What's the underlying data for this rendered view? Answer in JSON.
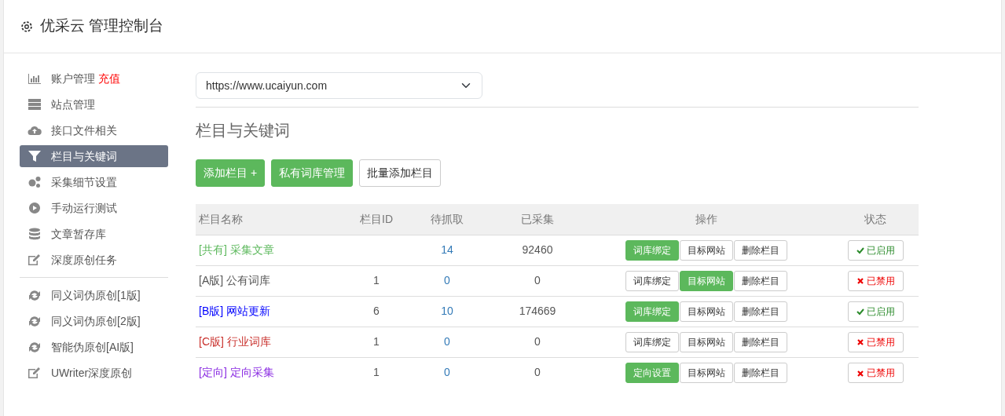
{
  "header": {
    "title": "优采云 管理控制台"
  },
  "sidebar": {
    "items": [
      {
        "label": "账户管理",
        "extra": "充值",
        "selected": false
      },
      {
        "label": "站点管理",
        "selected": false
      },
      {
        "label": "接口文件相关",
        "selected": false
      },
      {
        "label": "栏目与关键词",
        "selected": true
      },
      {
        "label": "采集细节设置",
        "selected": false
      },
      {
        "label": "手动运行测试",
        "selected": false
      },
      {
        "label": "文章暂存库",
        "selected": false
      },
      {
        "label": "深度原创任务",
        "selected": false
      }
    ],
    "tools": [
      {
        "label": "同义词伪原创[1版]"
      },
      {
        "label": "同义词伪原创[2版]"
      },
      {
        "label": "智能伪原创[AI版]"
      },
      {
        "label": "UWriter深度原创"
      }
    ]
  },
  "site_select": {
    "value": "https://www.ucaiyun.com"
  },
  "section_title": "栏目与关键词",
  "actions": [
    {
      "label": "添加栏目 +",
      "kind": "primary"
    },
    {
      "label": "私有词库管理",
      "kind": "primary"
    },
    {
      "label": "批量添加栏目",
      "kind": "outline"
    }
  ],
  "table": {
    "columns": [
      "栏目名称",
      "栏目ID",
      "待抓取",
      "已采集",
      "操作",
      "状态"
    ],
    "rows": [
      {
        "tag": "[共有]",
        "name": "采集文章",
        "color": "#5cb85c",
        "id": "",
        "pending": "14",
        "collected": "92460",
        "ops": [
          {
            "label": "词库绑定",
            "kind": "primary"
          },
          {
            "label": "目标网站",
            "kind": "outline"
          },
          {
            "label": "删除栏目",
            "kind": "outline"
          }
        ],
        "status": "已启用",
        "on": true
      },
      {
        "tag": "[A版]",
        "name": "公有词库",
        "color": "#555555",
        "id": "1",
        "pending": "0",
        "collected": "0",
        "ops": [
          {
            "label": "词库绑定",
            "kind": "outline"
          },
          {
            "label": "目标网站",
            "kind": "primary"
          },
          {
            "label": "删除栏目",
            "kind": "outline"
          }
        ],
        "status": "已禁用",
        "on": false
      },
      {
        "tag": "[B版]",
        "name": "网站更新",
        "color": "#0000ff",
        "id": "6",
        "pending": "10",
        "collected": "174669",
        "ops": [
          {
            "label": "词库绑定",
            "kind": "primary"
          },
          {
            "label": "目标网站",
            "kind": "outline"
          },
          {
            "label": "删除栏目",
            "kind": "outline"
          }
        ],
        "status": "已启用",
        "on": true
      },
      {
        "tag": "[C版]",
        "name": "行业词库",
        "color": "#c9302c",
        "id": "1",
        "pending": "0",
        "collected": "0",
        "ops": [
          {
            "label": "词库绑定",
            "kind": "outline"
          },
          {
            "label": "目标网站",
            "kind": "outline"
          },
          {
            "label": "删除栏目",
            "kind": "outline"
          }
        ],
        "status": "已禁用",
        "on": false
      },
      {
        "tag": "[定向]",
        "name": "定向采集",
        "color": "#8a2be2",
        "id": "1",
        "pending": "0",
        "collected": "0",
        "ops": [
          {
            "label": "定向设置",
            "kind": "primary"
          },
          {
            "label": "目标网站",
            "kind": "outline"
          },
          {
            "label": "删除栏目",
            "kind": "outline"
          }
        ],
        "status": "已禁用",
        "on": false
      }
    ]
  }
}
